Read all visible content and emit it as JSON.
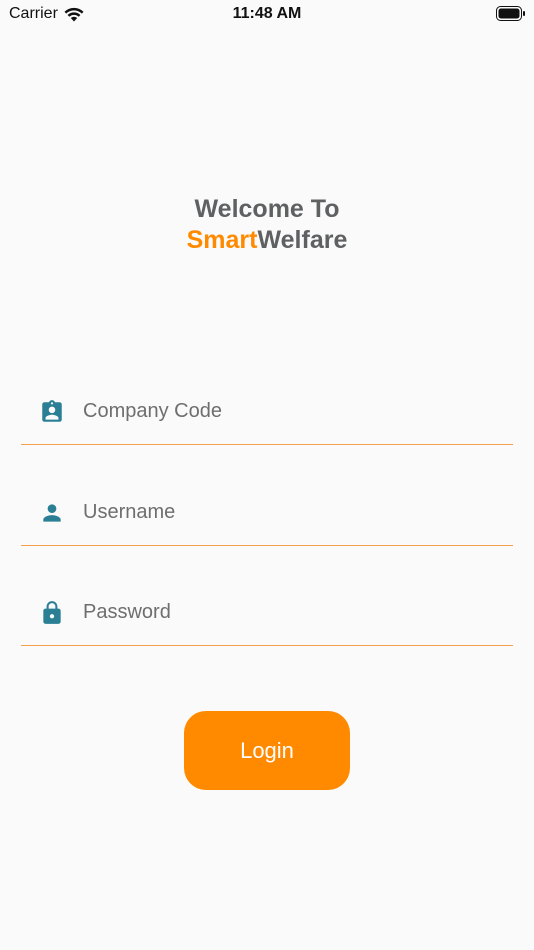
{
  "status_bar": {
    "carrier": "Carrier",
    "time": "11:48 AM"
  },
  "header": {
    "welcome": "Welcome To",
    "brand_part1": "Smart",
    "brand_part2": "Welfare"
  },
  "form": {
    "company_code": {
      "value": "",
      "placeholder": "Company Code",
      "icon": "badge-icon"
    },
    "username": {
      "value": "",
      "placeholder": "Username",
      "icon": "person-icon"
    },
    "password": {
      "value": "",
      "placeholder": "Password",
      "icon": "lock-icon"
    },
    "login_label": "Login"
  },
  "colors": {
    "accent": "#ff8a00",
    "icon": "#2b7f95",
    "title": "#5f6062",
    "underline": "#f5a04a",
    "background": "#fafafa"
  }
}
